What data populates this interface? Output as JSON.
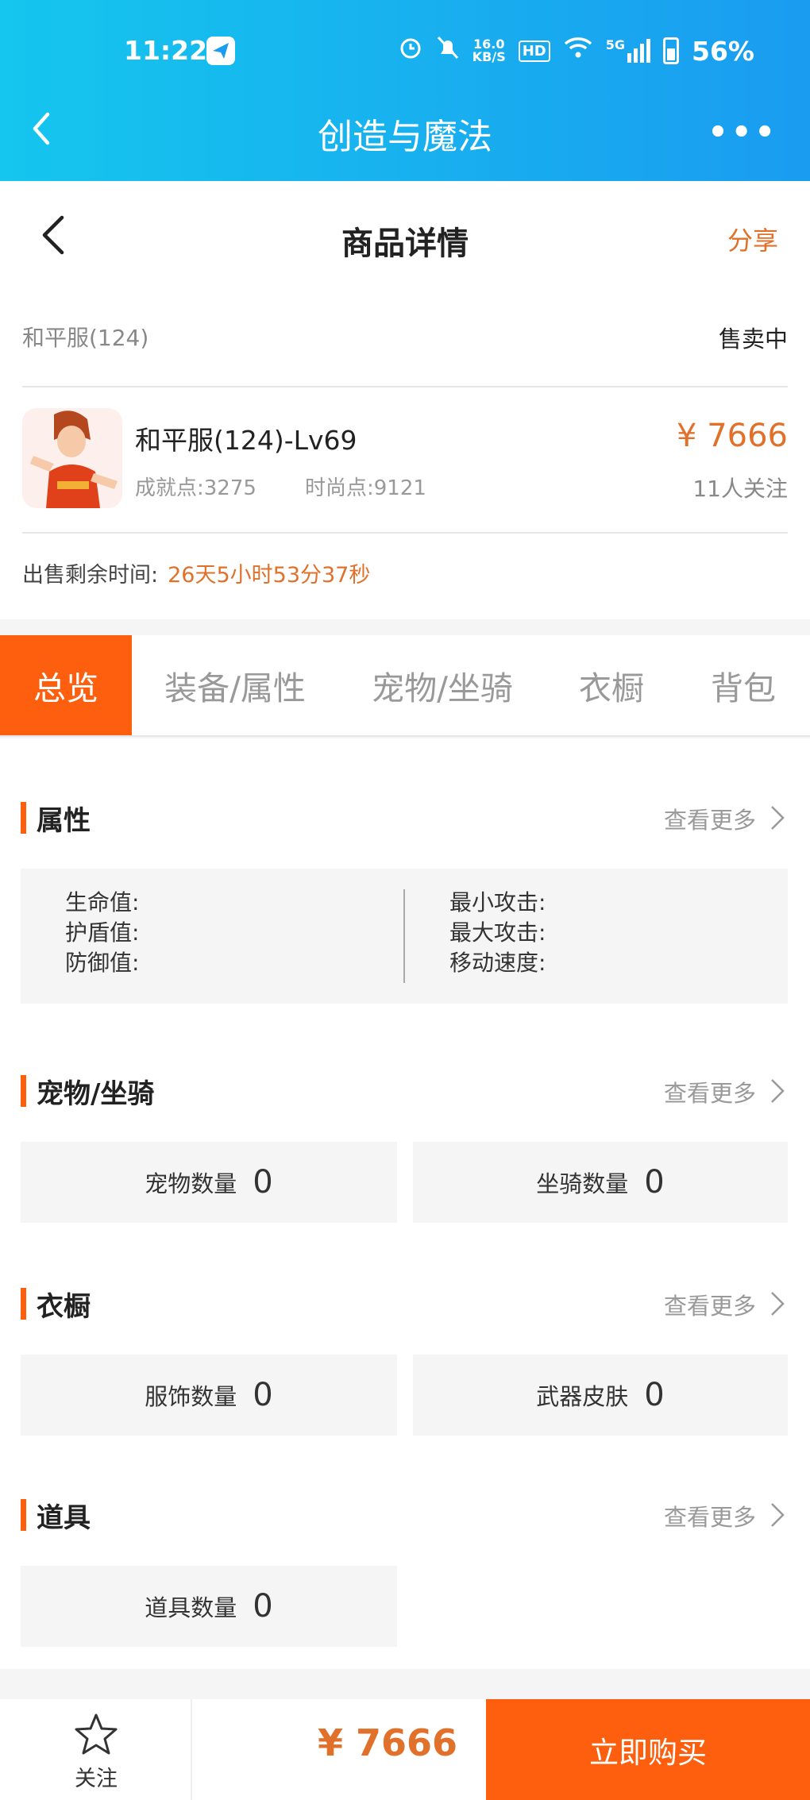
{
  "status_bar": {
    "time": "11:22",
    "net_speed_top": "16.0",
    "net_speed_unit": "KB/S",
    "hd": "HD",
    "signal": "5G",
    "battery": "56%"
  },
  "app_bar": {
    "title": "创造与魔法",
    "more": "•••"
  },
  "nav": {
    "title": "商品详情",
    "share": "分享"
  },
  "product": {
    "server": "和平服(124)",
    "status": "售卖中",
    "title": "和平服(124)-Lv69",
    "achievement": "成就点:3275",
    "fashion": "时尚点:9121",
    "price": "¥ 7666",
    "followers": "11人关注",
    "remaining_label": "出售剩余时间:",
    "remaining_value": "26天5小时53分37秒"
  },
  "tabs": [
    "总览",
    "装备/属性",
    "宠物/坐骑",
    "衣橱",
    "背包"
  ],
  "sections": {
    "more_label": "查看更多",
    "attributes": {
      "title": "属性",
      "left": [
        "生命值:",
        "护盾值:",
        "防御值:"
      ],
      "right": [
        "最小攻击:",
        "最大攻击:",
        "移动速度:"
      ]
    },
    "pets": {
      "title": "宠物/坐骑",
      "pet_label": "宠物数量",
      "pet_value": "0",
      "mount_label": "坐骑数量",
      "mount_value": "0"
    },
    "wardrobe": {
      "title": "衣橱",
      "outfit_label": "服饰数量",
      "outfit_value": "0",
      "skin_label": "武器皮肤",
      "skin_value": "0"
    },
    "items": {
      "title": "道具",
      "item_label": "道具数量",
      "item_value": "0"
    }
  },
  "bottom_bar": {
    "follow_label": "关注",
    "price": "¥ 7666",
    "buy_label": "立即购买"
  }
}
